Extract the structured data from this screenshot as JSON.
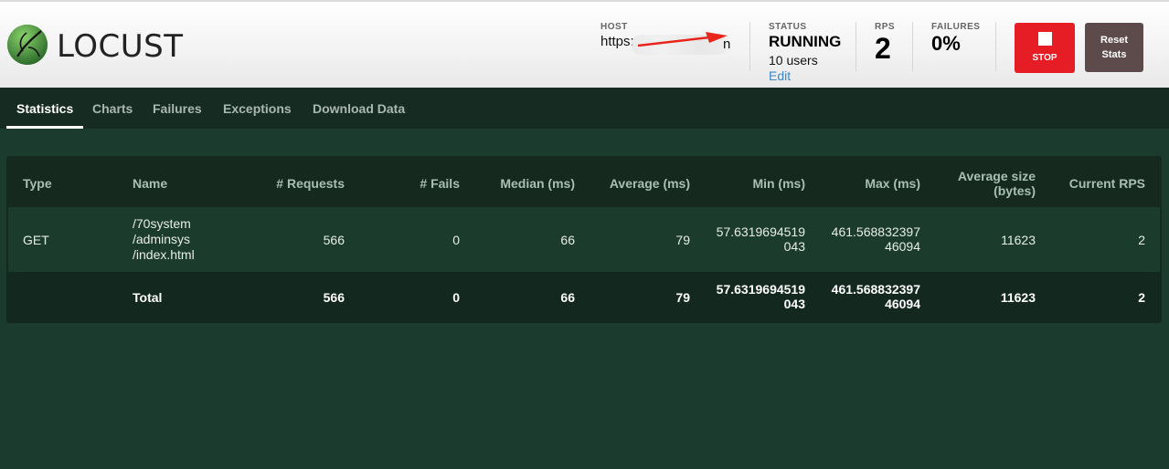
{
  "header": {
    "logo_text": "LOCUST",
    "host_label": "HOST",
    "host_prefix": "https:",
    "host_suffix": "n",
    "status_label": "STATUS",
    "status_value": "RUNNING",
    "users_text": "10 users",
    "edit_label": "Edit",
    "rps_label": "RPS",
    "rps_value": "2",
    "failures_label": "FAILURES",
    "failures_value": "0%",
    "stop_label": "STOP",
    "reset_label_line1": "Reset",
    "reset_label_line2": "Stats"
  },
  "tabs": [
    "Statistics",
    "Charts",
    "Failures",
    "Exceptions",
    "Download Data"
  ],
  "table": {
    "headers": {
      "type": "Type",
      "name": "Name",
      "requests": "# Requests",
      "fails": "# Fails",
      "median": "Median (ms)",
      "average": "Average (ms)",
      "min": "Min (ms)",
      "max": "Max (ms)",
      "avg_size_line1": "Average size",
      "avg_size_line2": "(bytes)",
      "current_rps": "Current RPS"
    },
    "row": {
      "type": "GET",
      "name_line1": "/70system",
      "name_line2": "/adminsys",
      "name_line3": "/index.html",
      "requests": "566",
      "fails": "0",
      "median": "66",
      "average": "79",
      "min_line1": "57.6319694519",
      "min_line2": "043",
      "max_line1": "461.568832397",
      "max_line2": "46094",
      "avg_size": "11623",
      "current_rps": "2"
    },
    "total": {
      "name": "Total",
      "requests": "566",
      "fails": "0",
      "median": "66",
      "average": "79",
      "min_line1": "57.6319694519",
      "min_line2": "043",
      "max_line1": "461.568832397",
      "max_line2": "46094",
      "avg_size": "11623",
      "current_rps": "2"
    }
  },
  "colors": {
    "stop_button": "#e61d24",
    "reset_button": "#5d4b4b",
    "background": "#1b3b2f",
    "edit_link": "#3b88c3",
    "annotation_arrow": "#e8261c"
  }
}
